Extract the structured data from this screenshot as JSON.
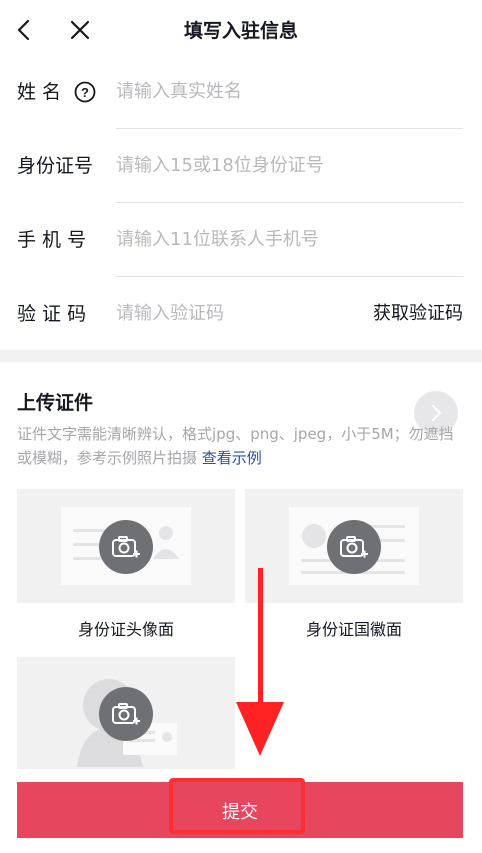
{
  "header": {
    "title": "填写入驻信息"
  },
  "form": {
    "name": {
      "label": "姓 名",
      "placeholder": "请输入真实姓名"
    },
    "id_number": {
      "label": "身份证号",
      "placeholder": "请输入15或18位身份证号"
    },
    "phone": {
      "label": "手 机 号",
      "placeholder": "请输入11位联系人手机号"
    },
    "code": {
      "label": "验 证 码",
      "placeholder": "请输入验证码",
      "action": "获取验证码"
    }
  },
  "upload": {
    "title": "上传证件",
    "description": "证件文字需能清晰辨认，格式jpg、png、jpeg，小于5M；勿遮挡或模糊，参考示例照片拍摄",
    "example_link": "查看示例",
    "cards": [
      {
        "caption": "身份证头像面"
      },
      {
        "caption": "身份证国徽面"
      }
    ]
  },
  "submit": {
    "label": "提交"
  },
  "colors": {
    "primary": "#e8455e",
    "link": "#2a4f9b",
    "placeholder": "#b8b9be",
    "annotation": "#ff2222"
  },
  "icons": [
    "back-icon",
    "close-icon",
    "help-icon",
    "chevron-right-icon",
    "camera-add-icon"
  ]
}
